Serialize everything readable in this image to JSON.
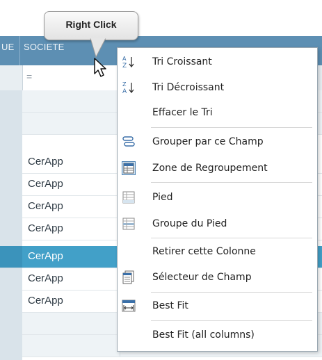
{
  "tooltip": {
    "text": "Right Click"
  },
  "grid": {
    "columns": [
      "UE",
      "SOCIETE"
    ],
    "filter_symbol": "=",
    "rows": [
      "",
      "",
      "CerApp",
      "CerApp",
      "CerApp",
      "CerApp",
      "CerApp",
      "CerApp",
      "CerApp",
      "",
      ""
    ],
    "selected_row_index": 6
  },
  "context_menu": {
    "items": [
      {
        "label": "Tri Croissant",
        "icon": "sort-ascending-icon"
      },
      {
        "label": "Tri Décroissant",
        "icon": "sort-descending-icon"
      },
      {
        "label": "Effacer le Tri",
        "icon": ""
      },
      {
        "label": "Grouper par ce Champ",
        "icon": "group-by-field-icon"
      },
      {
        "label": "Zone de Regroupement",
        "icon": "group-area-icon"
      },
      {
        "label": "Pied",
        "icon": "footer-icon"
      },
      {
        "label": "Groupe du Pied",
        "icon": "group-footer-icon"
      },
      {
        "label": "Retirer cette Colonne",
        "icon": ""
      },
      {
        "label": "Sélecteur de Champ",
        "icon": "field-chooser-icon"
      },
      {
        "label": "Best Fit",
        "icon": "best-fit-icon"
      },
      {
        "label": "Best Fit (all columns)",
        "icon": ""
      }
    ]
  },
  "colors": {
    "header": "#5d8fb3",
    "selected_row": "#42a0c8",
    "menu_border": "#9aa7b1"
  }
}
